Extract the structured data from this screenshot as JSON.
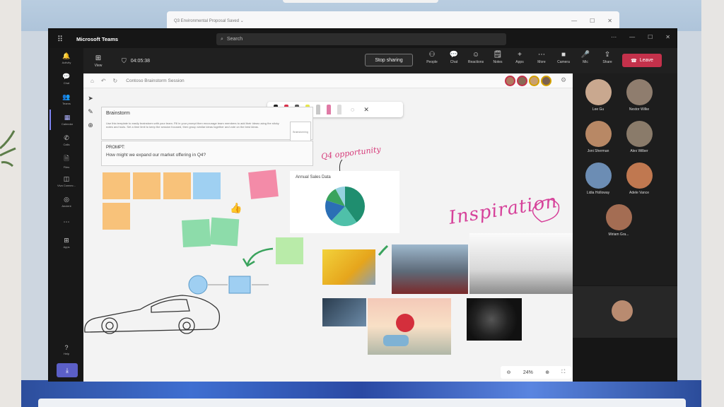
{
  "app": {
    "title": "Microsoft Teams",
    "search_placeholder": "Search",
    "bg_window_title": "Q3 Environmental Proposal  Saved ⌄"
  },
  "rail": {
    "items": [
      {
        "label": "Activity",
        "icon": "bell-icon",
        "glyph": "🔔"
      },
      {
        "label": "Chat",
        "icon": "chat-icon",
        "glyph": "💬"
      },
      {
        "label": "Teams",
        "icon": "teams-icon",
        "glyph": "👥"
      },
      {
        "label": "Calendar",
        "icon": "calendar-icon",
        "glyph": "▦"
      },
      {
        "label": "Calls",
        "icon": "phone-icon",
        "glyph": "✆"
      },
      {
        "label": "Files",
        "icon": "file-icon",
        "glyph": "🗎"
      },
      {
        "label": "Viva Connec...",
        "icon": "viva-icon",
        "glyph": "◫"
      },
      {
        "label": "Ancient",
        "icon": "compass-icon",
        "glyph": "◎"
      },
      {
        "label": "",
        "icon": "more-icon",
        "glyph": "⋯"
      },
      {
        "label": "Apps",
        "icon": "apps-icon",
        "glyph": "⊞"
      }
    ],
    "help": "Help"
  },
  "meeting": {
    "view_label": "View",
    "timer": "04:05:38",
    "stop_sharing": "Stop sharing",
    "actions": [
      {
        "label": "People",
        "glyph": "⚇",
        "icon": "people-icon"
      },
      {
        "label": "Chat",
        "glyph": "💬",
        "icon": "chat-icon"
      },
      {
        "label": "Reactions",
        "glyph": "☺",
        "icon": "reactions-icon"
      },
      {
        "label": "Notes",
        "glyph": "🗒",
        "icon": "notes-icon"
      },
      {
        "label": "Apps",
        "glyph": "+",
        "icon": "apps-plus-icon"
      },
      {
        "label": "More",
        "glyph": "⋯",
        "icon": "more-icon"
      }
    ],
    "device_actions": [
      {
        "label": "Camera",
        "glyph": "■",
        "icon": "camera-icon"
      },
      {
        "label": "Mic",
        "glyph": "🎤",
        "icon": "mic-icon"
      },
      {
        "label": "Share",
        "glyph": "⇪",
        "icon": "share-icon"
      }
    ],
    "leave": "Leave"
  },
  "whiteboard": {
    "title": "Contoso Brainstorm Session",
    "brainstorm": {
      "title": "Brainstorm",
      "text": "Use this template to easily brainstorm with your team. Fill in your prompt then encourage team members to add their ideas using the sticky notes and tools. Set a time limit to keep the session focused, then group similar ideas together and vote on the best ideas."
    },
    "prompt": {
      "label": "PROMPT:",
      "text": "How might we expand our market offering in Q4?"
    },
    "tag": "Brainstorming",
    "q4_note": "Q4 opportunity",
    "inspiration": "Inspiration",
    "zoom": "24%",
    "chart_title": "Annual Sales Data"
  },
  "participants": [
    {
      "name": "Lee Gu",
      "color": "#c9a88f"
    },
    {
      "name": "Nestor Wilke",
      "color": "#8f7d6e"
    },
    {
      "name": "Joni Sherman",
      "color": "#b88865"
    },
    {
      "name": "Alex Wilber",
      "color": "#8a7b6a"
    },
    {
      "name": "Lidia Holloway",
      "color": "#6c8db4"
    },
    {
      "name": "Adele Vance",
      "color": "#c07850"
    },
    {
      "name": "Miriam Gra...",
      "color": "#a46d53"
    }
  ],
  "chart_data": {
    "type": "pie",
    "title": "Annual Sales Data",
    "values": [
      40,
      22,
      18,
      12,
      8
    ],
    "colors": [
      "#1f8e6f",
      "#4fc0a9",
      "#2b6fb5",
      "#3aa35d",
      "#95d1e0"
    ]
  }
}
